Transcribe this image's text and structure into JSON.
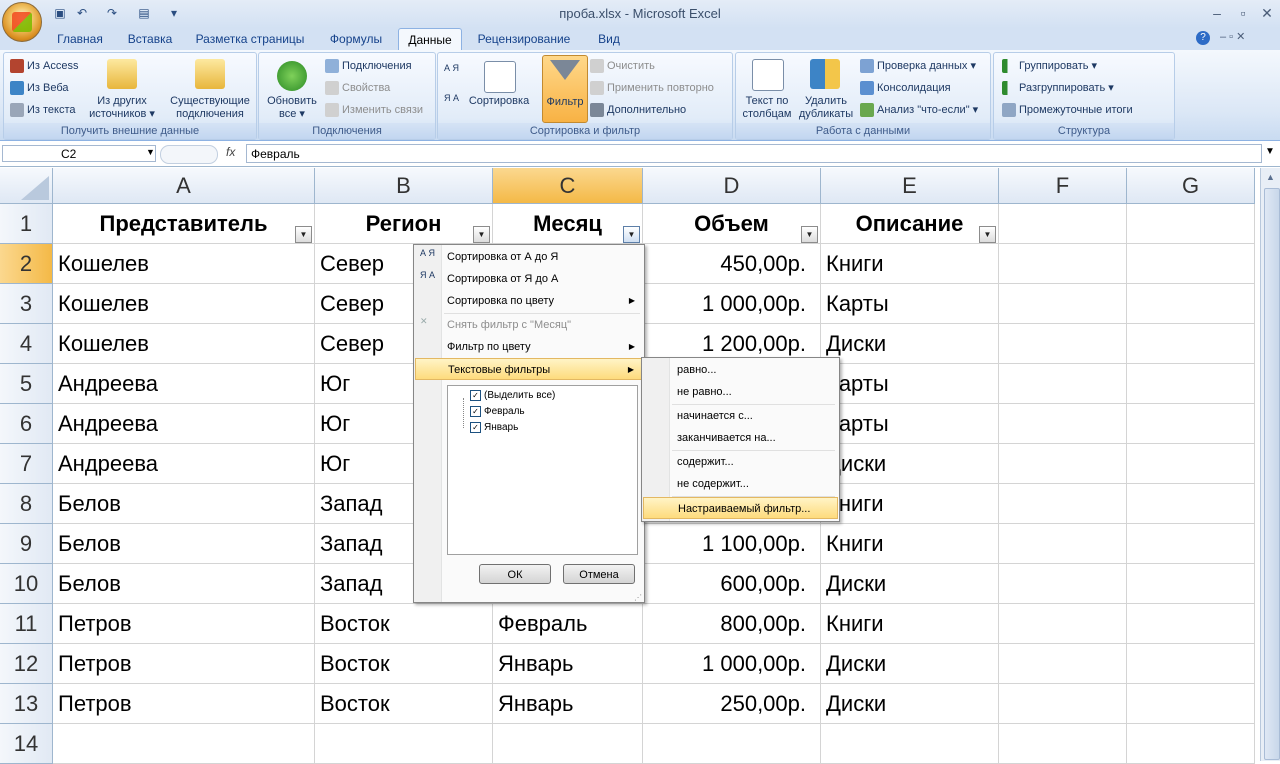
{
  "window": {
    "title": "проба.xlsx - Microsoft Excel",
    "minimize": "‒",
    "restore": "▫",
    "close": "✕"
  },
  "quick_access": {
    "save_icon": "save-icon",
    "undo_icon": "undo-icon",
    "redo_icon": "redo-icon"
  },
  "tabs": [
    "Главная",
    "Вставка",
    "Разметка страницы",
    "Формулы",
    "Данные",
    "Рецензирование",
    "Вид"
  ],
  "active_tab": "Данные",
  "ribbon": {
    "get_external": {
      "label": "Получить внешние данные",
      "from_access": "Из Access",
      "from_web": "Из Веба",
      "from_text": "Из текста",
      "from_other": "Из других источников ▾",
      "existing": "Существующие подключения"
    },
    "connections": {
      "label": "Подключения",
      "refresh_all": "Обновить все ▾",
      "connections": "Подключения",
      "properties": "Свойства",
      "edit_links": "Изменить связи"
    },
    "sort_filter": {
      "label": "Сортировка и фильтр",
      "sort": "Сортировка",
      "filter": "Фильтр",
      "clear": "Очистить",
      "reapply": "Применить повторно",
      "advanced": "Дополнительно",
      "az": "А Я",
      "za": "Я А"
    },
    "data_tools": {
      "label": "Работа с данными",
      "text_to_columns": "Текст по столбцам",
      "remove_duplicates": "Удалить дубликаты",
      "validation": "Проверка данных ▾",
      "consolidate": "Консолидация",
      "what_if": "Анализ \"что-если\" ▾"
    },
    "outline": {
      "label": "Структура",
      "group": "Группировать ▾",
      "ungroup": "Разгруппировать ▾",
      "subtotal": "Промежуточные итоги"
    }
  },
  "formula_bar": {
    "name_box": "C2",
    "fx": "fx",
    "value": "Февраль"
  },
  "columns": [
    "A",
    "B",
    "C",
    "D",
    "E",
    "F",
    "G"
  ],
  "selected_column": "C",
  "rows": [
    "1",
    "2",
    "3",
    "4",
    "5",
    "6",
    "7",
    "8",
    "9",
    "10",
    "11",
    "12",
    "13",
    "14"
  ],
  "headers": [
    "Представитель",
    "Регион",
    "Месяц",
    "Объем",
    "Описание"
  ],
  "table": [
    [
      "Кошелев",
      "Север",
      "",
      "450,00р.",
      "Книги"
    ],
    [
      "Кошелев",
      "Север",
      "",
      "1 000,00р.",
      "Карты"
    ],
    [
      "Кошелев",
      "Север",
      "",
      "1 200,00р.",
      "Диски"
    ],
    [
      "Андреева",
      "Юг",
      "",
      "",
      "Карты"
    ],
    [
      "Андреева",
      "Юг",
      "",
      "",
      "Карты"
    ],
    [
      "Андреева",
      "Юг",
      "",
      "",
      "Диски"
    ],
    [
      "Белов",
      "Запад",
      "",
      "",
      "Книги"
    ],
    [
      "Белов",
      "Запад",
      "",
      "1 100,00р.",
      "Книги"
    ],
    [
      "Белов",
      "Запад",
      "",
      "600,00р.",
      "Диски"
    ],
    [
      "Петров",
      "Восток",
      "Февраль",
      "800,00р.",
      "Книги"
    ],
    [
      "Петров",
      "Восток",
      "Январь",
      "1 000,00р.",
      "Диски"
    ],
    [
      "Петров",
      "Восток",
      "Январь",
      "250,00р.",
      "Диски"
    ]
  ],
  "filter_menu": {
    "sort_az": "Сортировка от А до Я",
    "sort_za": "Сортировка от Я до А",
    "sort_color": "Сортировка по цвету",
    "clear_filter": "Снять фильтр с \"Месяц\"",
    "filter_color": "Фильтр по цвету",
    "text_filters": "Текстовые фильтры",
    "select_all": "(Выделить все)",
    "values": [
      "Февраль",
      "Январь"
    ],
    "ok": "ОК",
    "cancel": "Отмена",
    "az_icon": "А Я",
    "za_icon": "Я А"
  },
  "text_filters_menu": [
    "равно...",
    "не равно...",
    "начинается с...",
    "заканчивается на...",
    "содержит...",
    "не содержит...",
    "Настраиваемый фильтр..."
  ],
  "highlighted_submenu_item": "Настраиваемый фильтр..."
}
